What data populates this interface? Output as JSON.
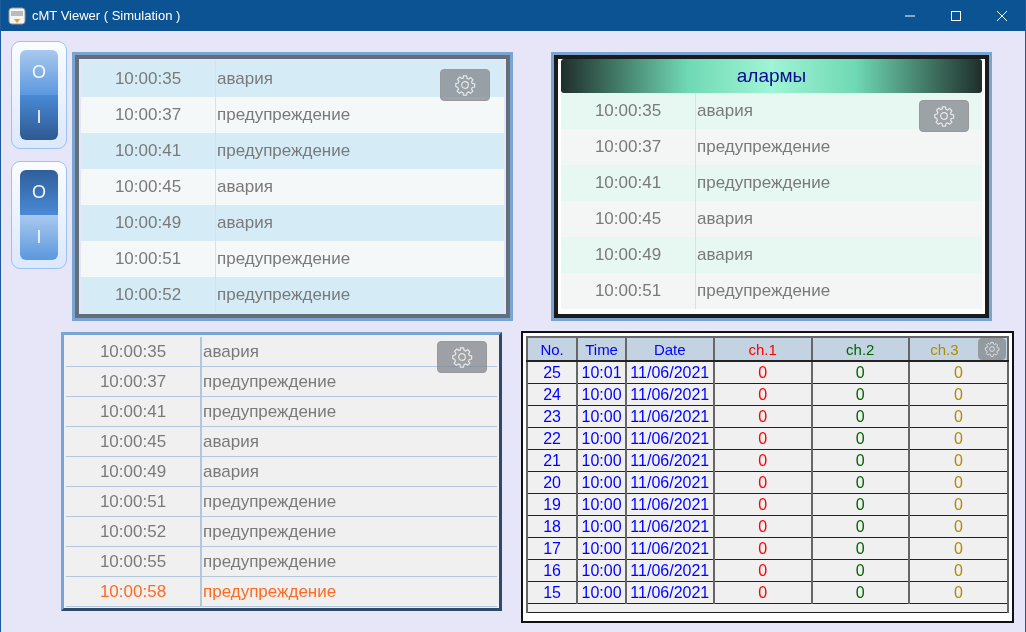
{
  "window": {
    "title": "cMT Viewer ( Simulation )"
  },
  "switches": [
    {
      "top": "O",
      "bottom": "I",
      "on": true
    },
    {
      "top": "O",
      "bottom": "I",
      "on": false
    }
  ],
  "alarm_panel_1": {
    "rows": [
      {
        "time": "10:00:35",
        "message": "авария"
      },
      {
        "time": "10:00:37",
        "message": "предупреждение"
      },
      {
        "time": "10:00:41",
        "message": "предупреждение"
      },
      {
        "time": "10:00:45",
        "message": "авария"
      },
      {
        "time": "10:00:49",
        "message": "авария"
      },
      {
        "time": "10:00:51",
        "message": "предупреждение"
      },
      {
        "time": "10:00:52",
        "message": "предупреждение"
      }
    ]
  },
  "alarm_panel_2": {
    "title": "алармы",
    "rows": [
      {
        "time": "10:00:35",
        "message": "авария"
      },
      {
        "time": "10:00:37",
        "message": "предупреждение"
      },
      {
        "time": "10:00:41",
        "message": "предупреждение"
      },
      {
        "time": "10:00:45",
        "message": "авария"
      },
      {
        "time": "10:00:49",
        "message": "авария"
      },
      {
        "time": "10:00:51",
        "message": "предупреждение"
      }
    ]
  },
  "alarm_panel_3": {
    "rows": [
      {
        "time": "10:00:35",
        "message": "авария",
        "active": false
      },
      {
        "time": "10:00:37",
        "message": "предупреждение",
        "active": false
      },
      {
        "time": "10:00:41",
        "message": "предупреждение",
        "active": false
      },
      {
        "time": "10:00:45",
        "message": "авария",
        "active": false
      },
      {
        "time": "10:00:49",
        "message": "авария",
        "active": false
      },
      {
        "time": "10:00:51",
        "message": "предупреждение",
        "active": false
      },
      {
        "time": "10:00:52",
        "message": "предупреждение",
        "active": false
      },
      {
        "time": "10:00:55",
        "message": "предупреждение",
        "active": false
      },
      {
        "time": "10:00:58",
        "message": "предупреждение",
        "active": true
      }
    ]
  },
  "data_table": {
    "columns": [
      {
        "label": "No.",
        "color": "#0000ff"
      },
      {
        "label": "Time",
        "color": "#0000ff"
      },
      {
        "label": "Date",
        "color": "#0000ff"
      },
      {
        "label": "ch.1",
        "color": "#ff0000"
      },
      {
        "label": "ch.2",
        "color": "#006400"
      },
      {
        "label": "ch.3",
        "color": "#b08a00"
      }
    ],
    "rows": [
      [
        "25",
        "10:01",
        "11/06/2021",
        "0",
        "0",
        "0"
      ],
      [
        "24",
        "10:00",
        "11/06/2021",
        "0",
        "0",
        "0"
      ],
      [
        "23",
        "10:00",
        "11/06/2021",
        "0",
        "0",
        "0"
      ],
      [
        "22",
        "10:00",
        "11/06/2021",
        "0",
        "0",
        "0"
      ],
      [
        "21",
        "10:00",
        "11/06/2021",
        "0",
        "0",
        "0"
      ],
      [
        "20",
        "10:00",
        "11/06/2021",
        "0",
        "0",
        "0"
      ],
      [
        "19",
        "10:00",
        "11/06/2021",
        "0",
        "0",
        "0"
      ],
      [
        "18",
        "10:00",
        "11/06/2021",
        "0",
        "0",
        "0"
      ],
      [
        "17",
        "10:00",
        "11/06/2021",
        "0",
        "0",
        "0"
      ],
      [
        "16",
        "10:00",
        "11/06/2021",
        "0",
        "0",
        "0"
      ],
      [
        "15",
        "10:00",
        "11/06/2021",
        "0",
        "0",
        "0"
      ]
    ]
  }
}
